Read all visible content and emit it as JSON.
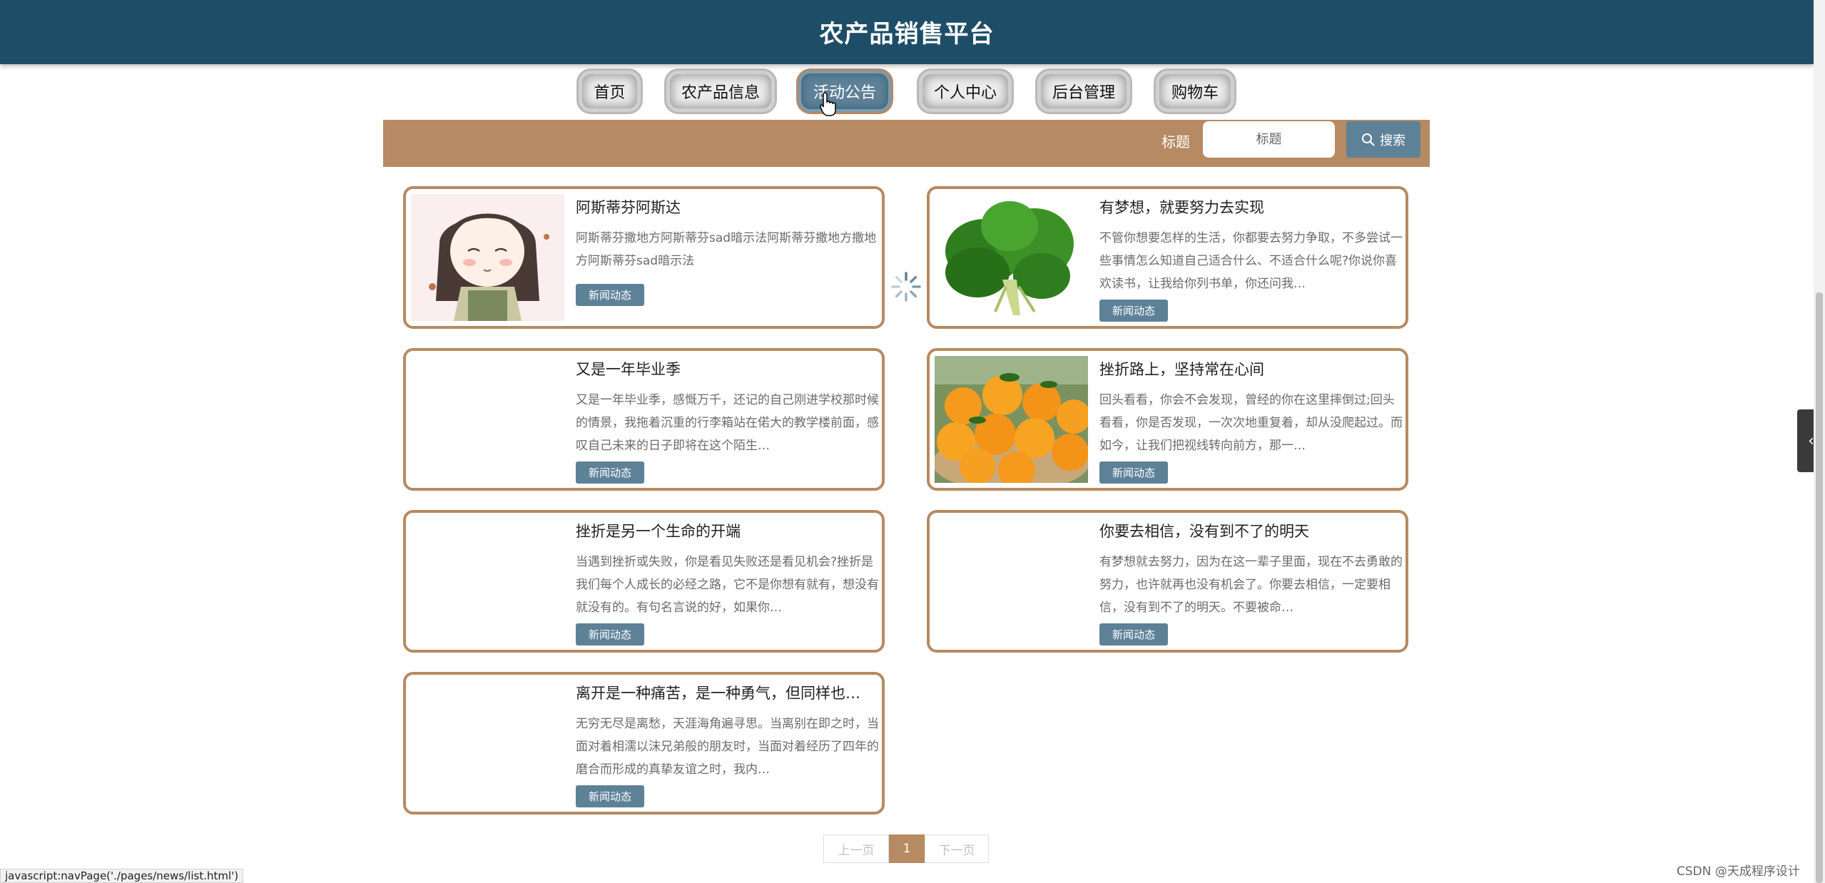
{
  "header": {
    "title": "农产品销售平台"
  },
  "nav": {
    "items": [
      {
        "label": "首页"
      },
      {
        "label": "农产品信息"
      },
      {
        "label": "活动公告"
      },
      {
        "label": "个人中心"
      },
      {
        "label": "后台管理"
      },
      {
        "label": "购物车"
      }
    ],
    "active": "活动公告"
  },
  "search": {
    "label": "标题",
    "placeholder": "标题",
    "button_label": "搜索"
  },
  "news": [
    {
      "title": "阿斯蒂芬阿斯达",
      "desc": "阿斯蒂芬撒地方阿斯蒂芬sad暗示法阿斯蒂芬撒地方撒地方阿斯蒂芬sad暗示法",
      "tag": "新闻动态",
      "image": "anime-girl"
    },
    {
      "title": "有梦想，就要努力去实现",
      "desc": "不管你想要怎样的生活，你都要去努力争取，不多尝试一些事情怎么知道自己适合什么、不适合什么呢?你说你喜欢读书，让我给你列书单，你还问我…",
      "tag": "新闻动态",
      "image": "spinach"
    },
    {
      "title": "又是一年毕业季",
      "desc": "又是一年毕业季，感慨万千，还记的自己刚进学校那时候的情景，我拖着沉重的行李箱站在偌大的教学楼前面，感叹自己未来的日子即将在这个陌生…",
      "tag": "新闻动态",
      "image": ""
    },
    {
      "title": "挫折路上，坚持常在心间",
      "desc": "回头看看，你会不会发现，曾经的你在这里摔倒过;回头看看，你是否发现，一次次地重复着，却从没爬起过。而如今，让我们把视线转向前方，那一…",
      "tag": "新闻动态",
      "image": "oranges"
    },
    {
      "title": "挫折是另一个生命的开端",
      "desc": "当遇到挫折或失败，你是看见失败还是看见机会?挫折是我们每个人成长的必经之路，它不是你想有就有，想没有就没有的。有句名言说的好，如果你…",
      "tag": "新闻动态",
      "image": ""
    },
    {
      "title": "你要去相信，没有到不了的明天",
      "desc": "有梦想就去努力，因为在这一辈子里面，现在不去勇敢的努力，也许就再也没有机会了。你要去相信，一定要相信，没有到不了的明天。不要被命…",
      "tag": "新闻动态",
      "image": ""
    },
    {
      "title": "离开是一种痛苦，是一种勇气，但同样也…",
      "desc": "无穷无尽是离愁，天涯海角遍寻思。当离别在即之时，当面对着相濡以沫兄弟般的朋友时，当面对着经历了四年的磨合而形成的真挚友谊之时，我内…",
      "tag": "新闻动态",
      "image": ""
    }
  ],
  "pager": {
    "prev": "上一页",
    "current": "1",
    "next": "下一页"
  },
  "status_url": "javascript:navPage('./pages/news/list.html')",
  "watermark": "CSDN @天成程序设计",
  "colors": {
    "header": "#1e4e67",
    "accent": "#b68a62",
    "button": "#5d8197"
  }
}
